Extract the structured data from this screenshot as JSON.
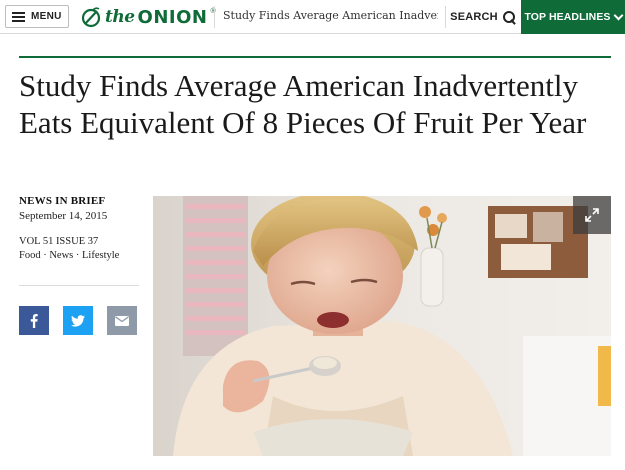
{
  "nav": {
    "menu_label": "MENU",
    "logo_the": "the",
    "logo_onion": "ONION",
    "logo_reg": "®",
    "headline_preview": "Study Finds Average American Inadvertentl",
    "search_label": "SEARCH",
    "top_headlines_label": "TOP HEADLINES",
    "accent_color": "#0f6b38"
  },
  "article": {
    "title": "Study Finds Average American Inadvertently Eats Equivalent Of 8 Pieces Of Fruit Per Year",
    "section": "NEWS IN BRIEF",
    "date": "September 14, 2015",
    "issue": "VOL 51 ISSUE 37",
    "tags": "Food · News · Lifestyle"
  },
  "share": {
    "facebook_icon": "facebook-icon",
    "twitter_icon": "twitter-icon",
    "email_icon": "email-icon",
    "facebook_color": "#3b5998",
    "twitter_color": "#1da1f2",
    "email_color": "#8e9aa7"
  },
  "photo": {
    "expand_icon": "expand-icon"
  }
}
